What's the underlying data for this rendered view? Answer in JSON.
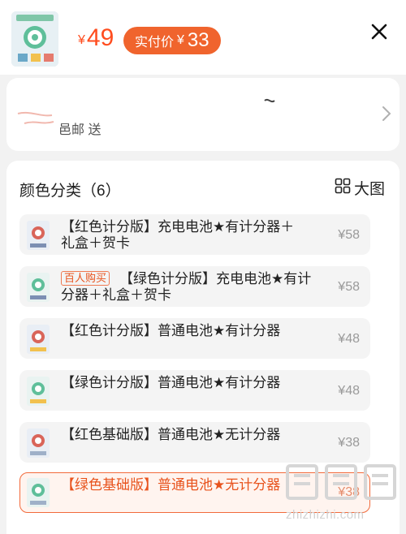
{
  "header": {
    "currency": "¥",
    "price": "49",
    "actual_label": "实付价",
    "actual_currency": "¥",
    "actual_price": "33",
    "close_icon": "close-icon"
  },
  "address": {
    "text": "邑邮  送    ",
    "chevron_icon": "chevron-right-icon"
  },
  "sku_section": {
    "title": "颜色分类（6）",
    "bigview_label": "大图",
    "bigview_icon": "grid-icon",
    "items": [
      {
        "name": "【红色计分版】充电电池★有计分器＋礼盒＋贺卡",
        "price": "¥58",
        "tag": ""
      },
      {
        "name": "【绿色计分版】充电电池★有计分器＋礼盒＋贺卡",
        "price": "¥58",
        "tag": "百人购买"
      },
      {
        "name": "【红色计分版】普通电池★有计分器",
        "price": "¥48",
        "tag": ""
      },
      {
        "name": "【绿色计分版】普通电池★有计分器",
        "price": "¥48",
        "tag": ""
      },
      {
        "name": "【红色基础版】普通电池★无计分器",
        "price": "¥38",
        "tag": ""
      },
      {
        "name": "【绿色基础版】普通电池★无计分器",
        "price": "¥38",
        "tag": "",
        "selected": true
      }
    ]
  },
  "watermark": {
    "text": "zhizhizhi.com"
  },
  "colors": {
    "accent": "#f0642d",
    "price_red": "#ff4d1f",
    "panel_bg": "#ffffff",
    "page_bg": "#f2f2f2"
  }
}
